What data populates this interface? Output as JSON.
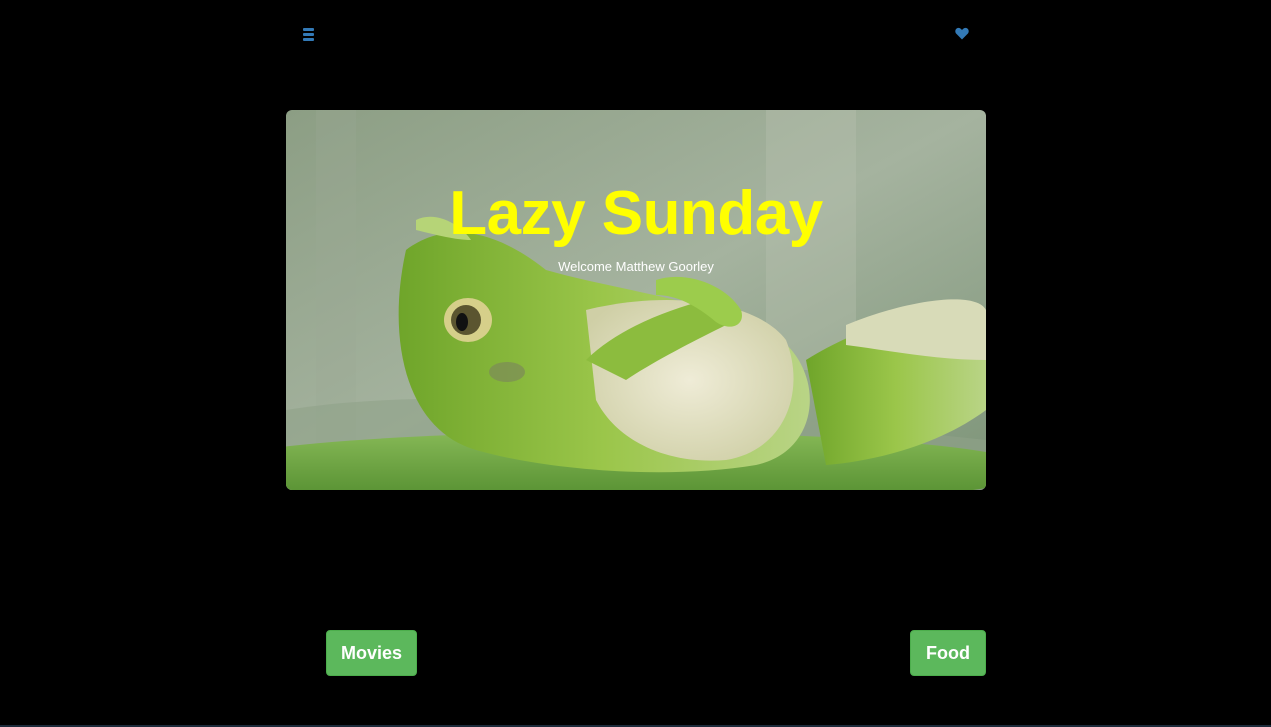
{
  "header": {
    "menu_icon": "hamburger-menu-icon",
    "favorite_icon": "heart-icon",
    "icon_color": "#337ab7"
  },
  "hero": {
    "title": "Lazy Sunday",
    "subtitle": "Welcome Matthew Goorley",
    "title_color": "#ffff00",
    "image": "frog-lounging-on-lily-pad"
  },
  "actions": {
    "left_label": "Movies",
    "right_label": "Food",
    "button_color": "#5cb85c"
  }
}
